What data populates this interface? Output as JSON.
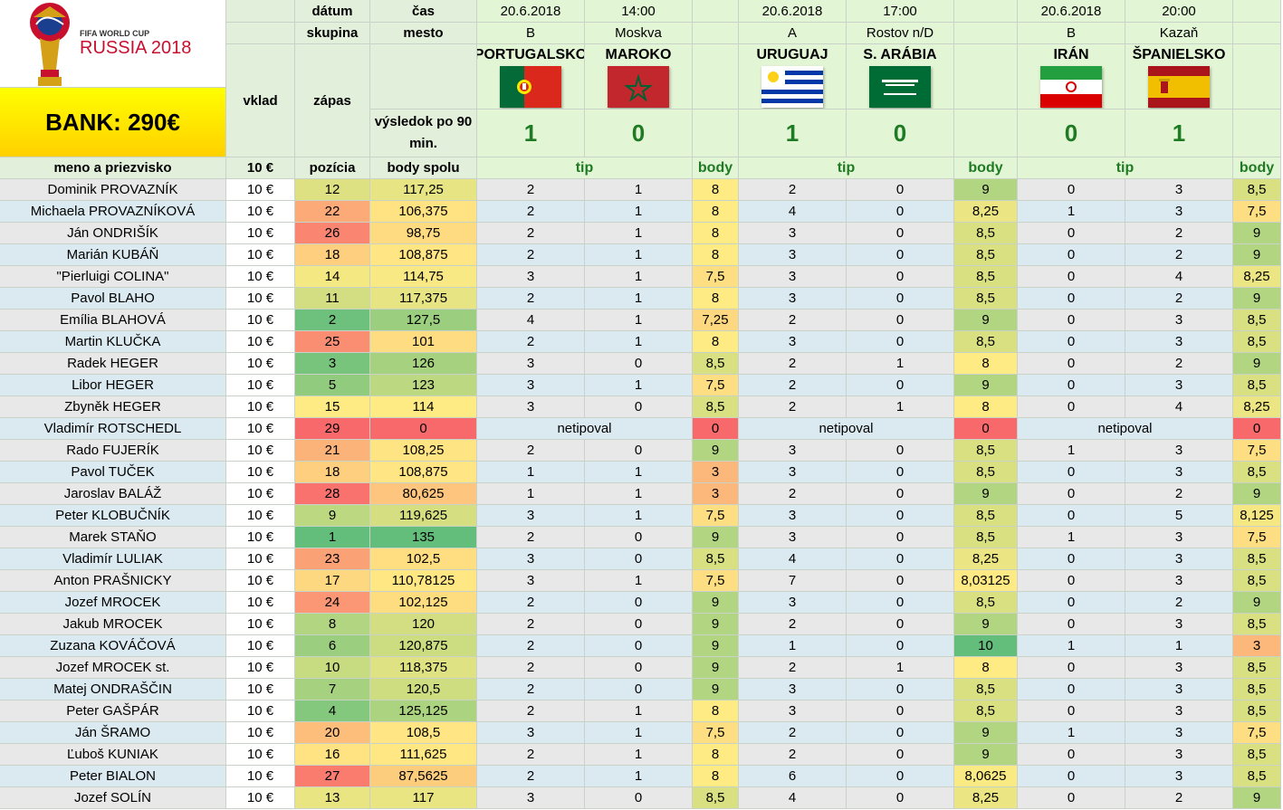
{
  "logo": {
    "line1": "FIFA WORLD CUP",
    "line2": "RUSSIA 2018"
  },
  "bank": "BANK: 290€",
  "headers": {
    "datum": "dátum",
    "cas": "čas",
    "skupina": "skupina",
    "mesto": "mesto",
    "vklad": "vklad",
    "zapas": "zápas",
    "vysledok": "výsledok po 90 min.",
    "meno": "meno a priezvisko",
    "vklad_amount": "10 €",
    "pozicia": "pozícia",
    "body_spolu": "body spolu"
  },
  "matches": [
    {
      "date": "20.6.2018",
      "time": "14:00",
      "group": "B",
      "city": "Moskva",
      "home": "PORTUGALSKO",
      "away": "MAROKO",
      "home_flag": "portugal-flag",
      "away_flag": "morocco-flag",
      "home_score": "1",
      "away_score": "0",
      "tip_label": "tip",
      "body_label": "body"
    },
    {
      "date": "20.6.2018",
      "time": "17:00",
      "group": "A",
      "city": "Rostov n/D",
      "home": "URUGUAJ",
      "away": "S. ARÁBIA",
      "home_flag": "uruguay-flag",
      "away_flag": "saudi-arabia-flag",
      "home_score": "1",
      "away_score": "0",
      "tip_label": "tip",
      "body_label": "body"
    },
    {
      "date": "20.6.2018",
      "time": "20:00",
      "group": "B",
      "city": "Kazaň",
      "home": "IRÁN",
      "away": "ŠPANIELSKO",
      "home_flag": "iran-flag",
      "away_flag": "spain-flag",
      "home_score": "0",
      "away_score": "1",
      "tip_label": "tip",
      "body_label": "body"
    }
  ],
  "colors": {
    "pos_best": "#63be7b",
    "pos_mid": "#ffeb84",
    "pos_worst": "#f8696b",
    "score_green": "#1e7b24",
    "bank_yellow": "#ffff00"
  },
  "no_tip_text": "netipoval",
  "players": [
    {
      "name": "Dominik PROVAZNÍK",
      "vklad": "10 €",
      "pos": "12",
      "total": "117,25",
      "m": [
        [
          "2",
          "1",
          "8"
        ],
        [
          "2",
          "0",
          "9"
        ],
        [
          "0",
          "3",
          "8,5"
        ]
      ]
    },
    {
      "name": "Michaela PROVAZNÍKOVÁ",
      "vklad": "10 €",
      "pos": "22",
      "total": "106,375",
      "m": [
        [
          "2",
          "1",
          "8"
        ],
        [
          "4",
          "0",
          "8,25"
        ],
        [
          "1",
          "3",
          "7,5"
        ]
      ]
    },
    {
      "name": "Ján ONDRIŠÍK",
      "vklad": "10 €",
      "pos": "26",
      "total": "98,75",
      "m": [
        [
          "2",
          "1",
          "8"
        ],
        [
          "3",
          "0",
          "8,5"
        ],
        [
          "0",
          "2",
          "9"
        ]
      ]
    },
    {
      "name": "Marián KUBÁŇ",
      "vklad": "10 €",
      "pos": "18",
      "total": "108,875",
      "m": [
        [
          "2",
          "1",
          "8"
        ],
        [
          "3",
          "0",
          "8,5"
        ],
        [
          "0",
          "2",
          "9"
        ]
      ]
    },
    {
      "name": "\"Pierluigi COLINA\"",
      "vklad": "10 €",
      "pos": "14",
      "total": "114,75",
      "m": [
        [
          "3",
          "1",
          "7,5"
        ],
        [
          "3",
          "0",
          "8,5"
        ],
        [
          "0",
          "4",
          "8,25"
        ]
      ]
    },
    {
      "name": "Pavol BLAHO",
      "vklad": "10 €",
      "pos": "11",
      "total": "117,375",
      "m": [
        [
          "2",
          "1",
          "8"
        ],
        [
          "3",
          "0",
          "8,5"
        ],
        [
          "0",
          "2",
          "9"
        ]
      ]
    },
    {
      "name": "Emília BLAHOVÁ",
      "vklad": "10 €",
      "pos": "2",
      "total": "127,5",
      "m": [
        [
          "4",
          "1",
          "7,25"
        ],
        [
          "2",
          "0",
          "9"
        ],
        [
          "0",
          "3",
          "8,5"
        ]
      ]
    },
    {
      "name": "Martin KLUČKA",
      "vklad": "10 €",
      "pos": "25",
      "total": "101",
      "m": [
        [
          "2",
          "1",
          "8"
        ],
        [
          "3",
          "0",
          "8,5"
        ],
        [
          "0",
          "3",
          "8,5"
        ]
      ]
    },
    {
      "name": "Radek HEGER",
      "vklad": "10 €",
      "pos": "3",
      "total": "126",
      "m": [
        [
          "3",
          "0",
          "8,5"
        ],
        [
          "2",
          "1",
          "8"
        ],
        [
          "0",
          "2",
          "9"
        ]
      ]
    },
    {
      "name": "Libor HEGER",
      "vklad": "10 €",
      "pos": "5",
      "total": "123",
      "m": [
        [
          "3",
          "1",
          "7,5"
        ],
        [
          "2",
          "0",
          "9"
        ],
        [
          "0",
          "3",
          "8,5"
        ]
      ]
    },
    {
      "name": "Zbyněk HEGER",
      "vklad": "10 €",
      "pos": "15",
      "total": "114",
      "m": [
        [
          "3",
          "0",
          "8,5"
        ],
        [
          "2",
          "1",
          "8"
        ],
        [
          "0",
          "4",
          "8,25"
        ]
      ]
    },
    {
      "name": "Vladimír ROTSCHEDL",
      "vklad": "10 €",
      "pos": "29",
      "total": "0",
      "notip": true,
      "m": [
        [
          "",
          "",
          "0"
        ],
        [
          "",
          "",
          "0"
        ],
        [
          "",
          "",
          "0"
        ]
      ]
    },
    {
      "name": "Rado FUJERÍK",
      "vklad": "10 €",
      "pos": "21",
      "total": "108,25",
      "m": [
        [
          "2",
          "0",
          "9"
        ],
        [
          "3",
          "0",
          "8,5"
        ],
        [
          "1",
          "3",
          "7,5"
        ]
      ]
    },
    {
      "name": "Pavol TUČEK",
      "vklad": "10 €",
      "pos": "18",
      "total": "108,875",
      "m": [
        [
          "1",
          "1",
          "3"
        ],
        [
          "3",
          "0",
          "8,5"
        ],
        [
          "0",
          "3",
          "8,5"
        ]
      ]
    },
    {
      "name": "Jaroslav BALÁŽ",
      "vklad": "10 €",
      "pos": "28",
      "total": "80,625",
      "m": [
        [
          "1",
          "1",
          "3"
        ],
        [
          "2",
          "0",
          "9"
        ],
        [
          "0",
          "2",
          "9"
        ]
      ]
    },
    {
      "name": "Peter KLOBUČNÍK",
      "vklad": "10 €",
      "pos": "9",
      "total": "119,625",
      "m": [
        [
          "3",
          "1",
          "7,5"
        ],
        [
          "3",
          "0",
          "8,5"
        ],
        [
          "0",
          "5",
          "8,125"
        ]
      ]
    },
    {
      "name": "Marek STAŇO",
      "vklad": "10 €",
      "pos": "1",
      "total": "135",
      "m": [
        [
          "2",
          "0",
          "9"
        ],
        [
          "3",
          "0",
          "8,5"
        ],
        [
          "1",
          "3",
          "7,5"
        ]
      ]
    },
    {
      "name": "Vladimír LULIAK",
      "vklad": "10 €",
      "pos": "23",
      "total": "102,5",
      "m": [
        [
          "3",
          "0",
          "8,5"
        ],
        [
          "4",
          "0",
          "8,25"
        ],
        [
          "0",
          "3",
          "8,5"
        ]
      ]
    },
    {
      "name": "Anton PRAŠNICKY",
      "vklad": "10 €",
      "pos": "17",
      "total": "110,78125",
      "m": [
        [
          "3",
          "1",
          "7,5"
        ],
        [
          "7",
          "0",
          "8,03125"
        ],
        [
          "0",
          "3",
          "8,5"
        ]
      ]
    },
    {
      "name": "Jozef MROCEK",
      "vklad": "10 €",
      "pos": "24",
      "total": "102,125",
      "m": [
        [
          "2",
          "0",
          "9"
        ],
        [
          "3",
          "0",
          "8,5"
        ],
        [
          "0",
          "2",
          "9"
        ]
      ]
    },
    {
      "name": "Jakub MROCEK",
      "vklad": "10 €",
      "pos": "8",
      "total": "120",
      "m": [
        [
          "2",
          "0",
          "9"
        ],
        [
          "2",
          "0",
          "9"
        ],
        [
          "0",
          "3",
          "8,5"
        ]
      ]
    },
    {
      "name": "Zuzana KOVÁČOVÁ",
      "vklad": "10 €",
      "pos": "6",
      "total": "120,875",
      "m": [
        [
          "2",
          "0",
          "9"
        ],
        [
          "1",
          "0",
          "10"
        ],
        [
          "1",
          "1",
          "3"
        ]
      ]
    },
    {
      "name": "Jozef MROCEK st.",
      "vklad": "10 €",
      "pos": "10",
      "total": "118,375",
      "m": [
        [
          "2",
          "0",
          "9"
        ],
        [
          "2",
          "1",
          "8"
        ],
        [
          "0",
          "3",
          "8,5"
        ]
      ]
    },
    {
      "name": "Matej ONDRAŠČIN",
      "vklad": "10 €",
      "pos": "7",
      "total": "120,5",
      "m": [
        [
          "2",
          "0",
          "9"
        ],
        [
          "3",
          "0",
          "8,5"
        ],
        [
          "0",
          "3",
          "8,5"
        ]
      ]
    },
    {
      "name": "Peter GAŠPÁR",
      "vklad": "10 €",
      "pos": "4",
      "total": "125,125",
      "m": [
        [
          "2",
          "1",
          "8"
        ],
        [
          "3",
          "0",
          "8,5"
        ],
        [
          "0",
          "3",
          "8,5"
        ]
      ]
    },
    {
      "name": "Ján ŠRAMO",
      "vklad": "10 €",
      "pos": "20",
      "total": "108,5",
      "m": [
        [
          "3",
          "1",
          "7,5"
        ],
        [
          "2",
          "0",
          "9"
        ],
        [
          "1",
          "3",
          "7,5"
        ]
      ]
    },
    {
      "name": "Ľuboš KUNIAK",
      "vklad": "10 €",
      "pos": "16",
      "total": "111,625",
      "m": [
        [
          "2",
          "1",
          "8"
        ],
        [
          "2",
          "0",
          "9"
        ],
        [
          "0",
          "3",
          "8,5"
        ]
      ]
    },
    {
      "name": "Peter BIALON",
      "vklad": "10 €",
      "pos": "27",
      "total": "87,5625",
      "m": [
        [
          "2",
          "1",
          "8"
        ],
        [
          "6",
          "0",
          "8,0625"
        ],
        [
          "0",
          "3",
          "8,5"
        ]
      ]
    },
    {
      "name": "Jozef SOLÍN",
      "vklad": "10 €",
      "pos": "13",
      "total": "117",
      "m": [
        [
          "3",
          "0",
          "8,5"
        ],
        [
          "4",
          "0",
          "8,25"
        ],
        [
          "0",
          "2",
          "9"
        ]
      ]
    }
  ]
}
